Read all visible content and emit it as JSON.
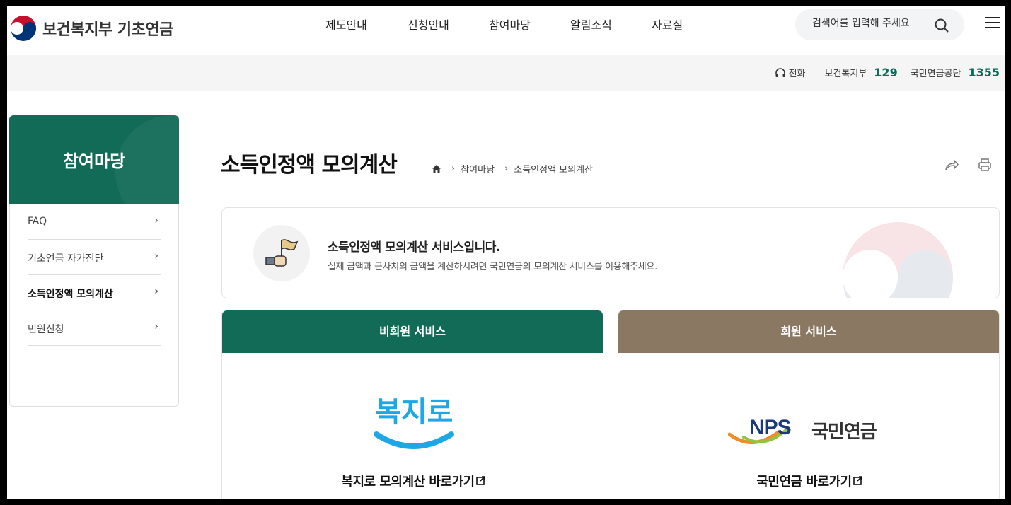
{
  "header": {
    "site_name": "보건복지부 기초연금",
    "nav": [
      "제도안내",
      "신청안내",
      "참여마당",
      "알림소식",
      "자료실"
    ],
    "search_placeholder": "검색어를 입력해 주세요"
  },
  "contact": {
    "label": "전화",
    "org1": "보건복지부",
    "num1": "129",
    "org2": "국민연금공단",
    "num2": "1355"
  },
  "sidebar": {
    "title": "참여마당",
    "items": [
      {
        "label": "FAQ"
      },
      {
        "label": "기초연금 자가진단"
      },
      {
        "label": "소득인정액 모의계산"
      },
      {
        "label": "민원신청"
      }
    ]
  },
  "page": {
    "title": "소득인정액 모의계산",
    "breadcrumb": [
      "참여마당",
      "소득인정액 모의계산"
    ]
  },
  "notice": {
    "title": "소득인정액 모의계산 서비스입니다.",
    "desc": "실제 금액과 근사치의 금액을 계산하시려면 국민연금의 모의계산 서비스를 이용해주세요."
  },
  "cards": {
    "nonmember": {
      "header": "비회원 서비스",
      "logo_text": "복지로",
      "link": "복지로 모의계산 바로가기"
    },
    "member": {
      "header": "회원 서비스",
      "logo_en": "NPS",
      "logo_ko": "국민연금",
      "link": "국민연금 바로가기"
    }
  },
  "colors": {
    "primary": "#116b57",
    "secondary": "#8a7862",
    "accent_number": "#0d6b57"
  }
}
